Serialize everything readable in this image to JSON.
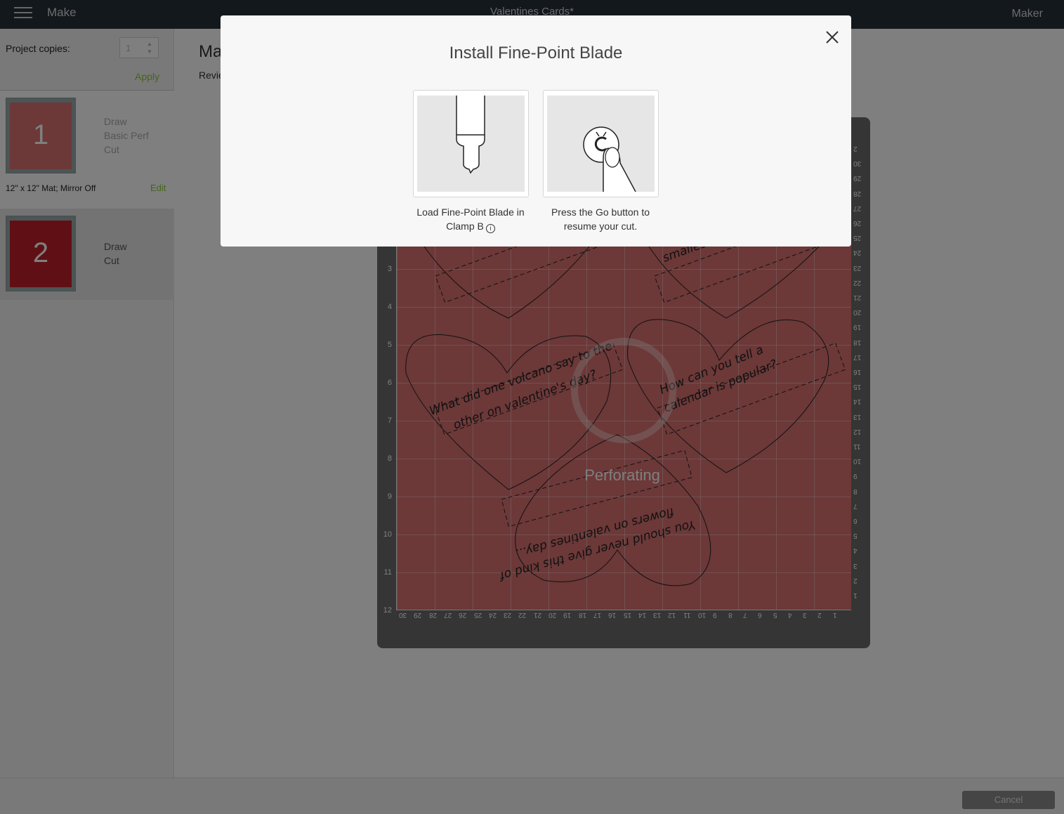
{
  "topbar": {
    "app_title": "Make",
    "document_title": "Valentines Cards*",
    "machine": "Maker"
  },
  "sidebar": {
    "copies_label": "Project copies:",
    "copies_value": "1",
    "apply_label": "Apply",
    "mats": [
      {
        "number": "1",
        "ops": [
          "Draw",
          "Basic Perf",
          "Cut"
        ],
        "info": "12\" x 12\" Mat; Mirror Off",
        "edit_label": "Edit",
        "color": "#d97171"
      },
      {
        "number": "2",
        "ops": [
          "Draw",
          "Cut"
        ],
        "color": "#c0202a"
      }
    ]
  },
  "main": {
    "title": "Ma",
    "subtitle": "Revie",
    "status": "Perforating",
    "ruler_left": [
      "3",
      "4",
      "5",
      "6",
      "7",
      "8",
      "9",
      "10",
      "11",
      "12"
    ],
    "ruler_bottom": [
      "30",
      "29",
      "28",
      "27",
      "26",
      "25",
      "24",
      "23",
      "22",
      "21",
      "20",
      "19",
      "18",
      "17",
      "16",
      "15",
      "14",
      "13",
      "12",
      "11",
      "10",
      "9",
      "8",
      "7",
      "6",
      "5",
      "4",
      "3",
      "2",
      "1"
    ],
    "ruler_right": [
      "2",
      "30",
      "29",
      "28",
      "27",
      "26",
      "25",
      "24",
      "23",
      "22",
      "21",
      "20",
      "19",
      "18",
      "17",
      "16",
      "15",
      "14",
      "13",
      "12",
      "11",
      "10",
      "9",
      "8",
      "7",
      "6",
      "5",
      "4",
      "3",
      "2",
      "1"
    ],
    "card_texts": [
      "What did one volcano say to the",
      "other on valentine's day?",
      "How can you tell a",
      "calendar is popular?",
      "You should never give this kind of",
      "flowers on valentines day...",
      "smalles"
    ]
  },
  "modal": {
    "title": "Install Fine-Point Blade",
    "step1_line1": "Load Fine-Point Blade in",
    "step1_line2": "Clamp B",
    "step2_line1": "Press the Go button to",
    "step2_line2": "resume your cut.",
    "info_glyph": "i"
  },
  "footer": {
    "cancel_label": "Cancel"
  }
}
